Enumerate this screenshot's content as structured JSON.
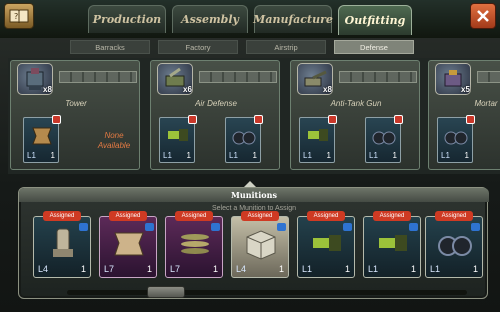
{
  "header": {
    "tabs": [
      "Production",
      "Assembly",
      "Manufacture",
      "Outfitting"
    ],
    "active_tab": "Outfitting"
  },
  "subtabs": {
    "items": [
      "Barracks",
      "Factory",
      "Airstrip",
      "Defense"
    ],
    "active": "Defense"
  },
  "defense_units": [
    {
      "name": "Tower",
      "count": "x8",
      "slots": [
        {
          "level": "L1",
          "qty": "1"
        }
      ],
      "none_text": "None Available"
    },
    {
      "name": "Air Defense",
      "count": "x6",
      "slots": [
        {
          "level": "L1",
          "qty": "1"
        },
        {
          "level": "L1",
          "qty": "1"
        }
      ]
    },
    {
      "name": "Anti-Tank Gun",
      "count": "x8",
      "slots": [
        {
          "level": "L1",
          "qty": "1"
        },
        {
          "level": "L1",
          "qty": "1"
        }
      ]
    },
    {
      "name": "Mortar",
      "count": "x5",
      "slots": [
        {
          "level": "L1",
          "qty": "1"
        }
      ]
    }
  ],
  "munitions": {
    "title": "Munitions",
    "subtitle": "Select a Munition to Assign",
    "items": [
      {
        "tag": "Assigned",
        "level": "L4",
        "qty": "1",
        "style": "blue",
        "icon": "ejection-seat-icon"
      },
      {
        "tag": "Assigned",
        "level": "L7",
        "qty": "1",
        "style": "purple",
        "icon": "armor-plate-icon"
      },
      {
        "tag": "Assigned",
        "level": "L7",
        "qty": "1",
        "style": "purple",
        "icon": "missiles-icon"
      },
      {
        "tag": "Assigned",
        "level": "L4",
        "qty": "1",
        "style": "tan",
        "icon": "armor-crate-icon"
      },
      {
        "tag": "Assigned",
        "level": "L1",
        "qty": "1",
        "style": "blue",
        "icon": "scope-icon"
      },
      {
        "tag": "Assigned",
        "level": "L1",
        "qty": "1",
        "style": "blue",
        "icon": "scope-icon"
      },
      {
        "tag": "Assigned",
        "level": "L1",
        "qty": "1",
        "style": "blue",
        "icon": "binoculars-icon"
      }
    ]
  },
  "colors": {
    "accent": "#cf3a23",
    "panel": "#2f3531",
    "slot_blue": "#294552",
    "slot_purple": "#5c2a58"
  }
}
